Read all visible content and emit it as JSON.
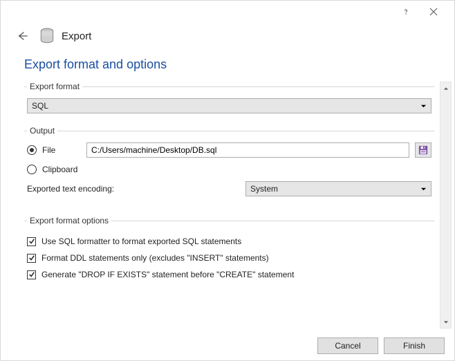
{
  "window": {
    "title": "Export"
  },
  "page": {
    "title": "Export format and options"
  },
  "export_format": {
    "legend": "Export format",
    "value": "SQL"
  },
  "output": {
    "legend": "Output",
    "file_label": "File",
    "file_path": "C:/Users/machine/Desktop/DB.sql",
    "clipboard_label": "Clipboard",
    "encoding_label": "Exported text encoding:",
    "encoding_value": "System",
    "selected": "file"
  },
  "options": {
    "legend": "Export format options",
    "opt1": "Use SQL formatter to format exported SQL statements",
    "opt2": "Format DDL statements only (excludes \"INSERT\" statements)",
    "opt3": "Generate \"DROP IF EXISTS\" statement before \"CREATE\" statement"
  },
  "footer": {
    "cancel": "Cancel",
    "finish": "Finish"
  }
}
